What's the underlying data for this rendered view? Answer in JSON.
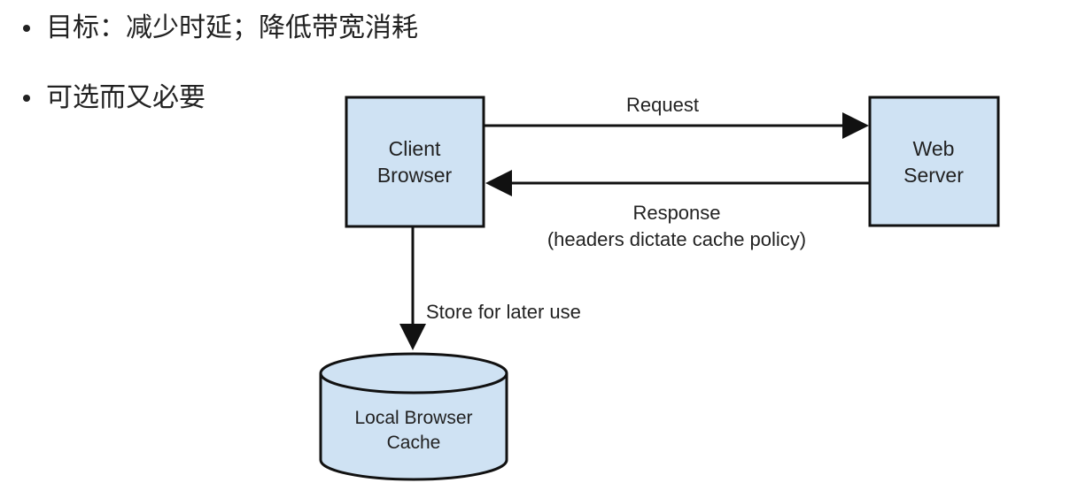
{
  "bullets": [
    {
      "text": "目标：减少时延；降低带宽消耗"
    },
    {
      "text": "可选而又必要"
    }
  ],
  "diagram": {
    "nodes": {
      "client": {
        "line1": "Client",
        "line2": "Browser"
      },
      "server": {
        "line1": "Web",
        "line2": "Server"
      },
      "cache": {
        "line1": "Local Browser",
        "line2": "Cache"
      }
    },
    "edges": {
      "request": {
        "label": "Request"
      },
      "response": {
        "label": "Response",
        "sublabel": "(headers dictate cache policy)"
      },
      "store": {
        "label": "Store for later use"
      }
    },
    "colors": {
      "box_fill": "#cfe2f3",
      "stroke": "#111111"
    }
  }
}
